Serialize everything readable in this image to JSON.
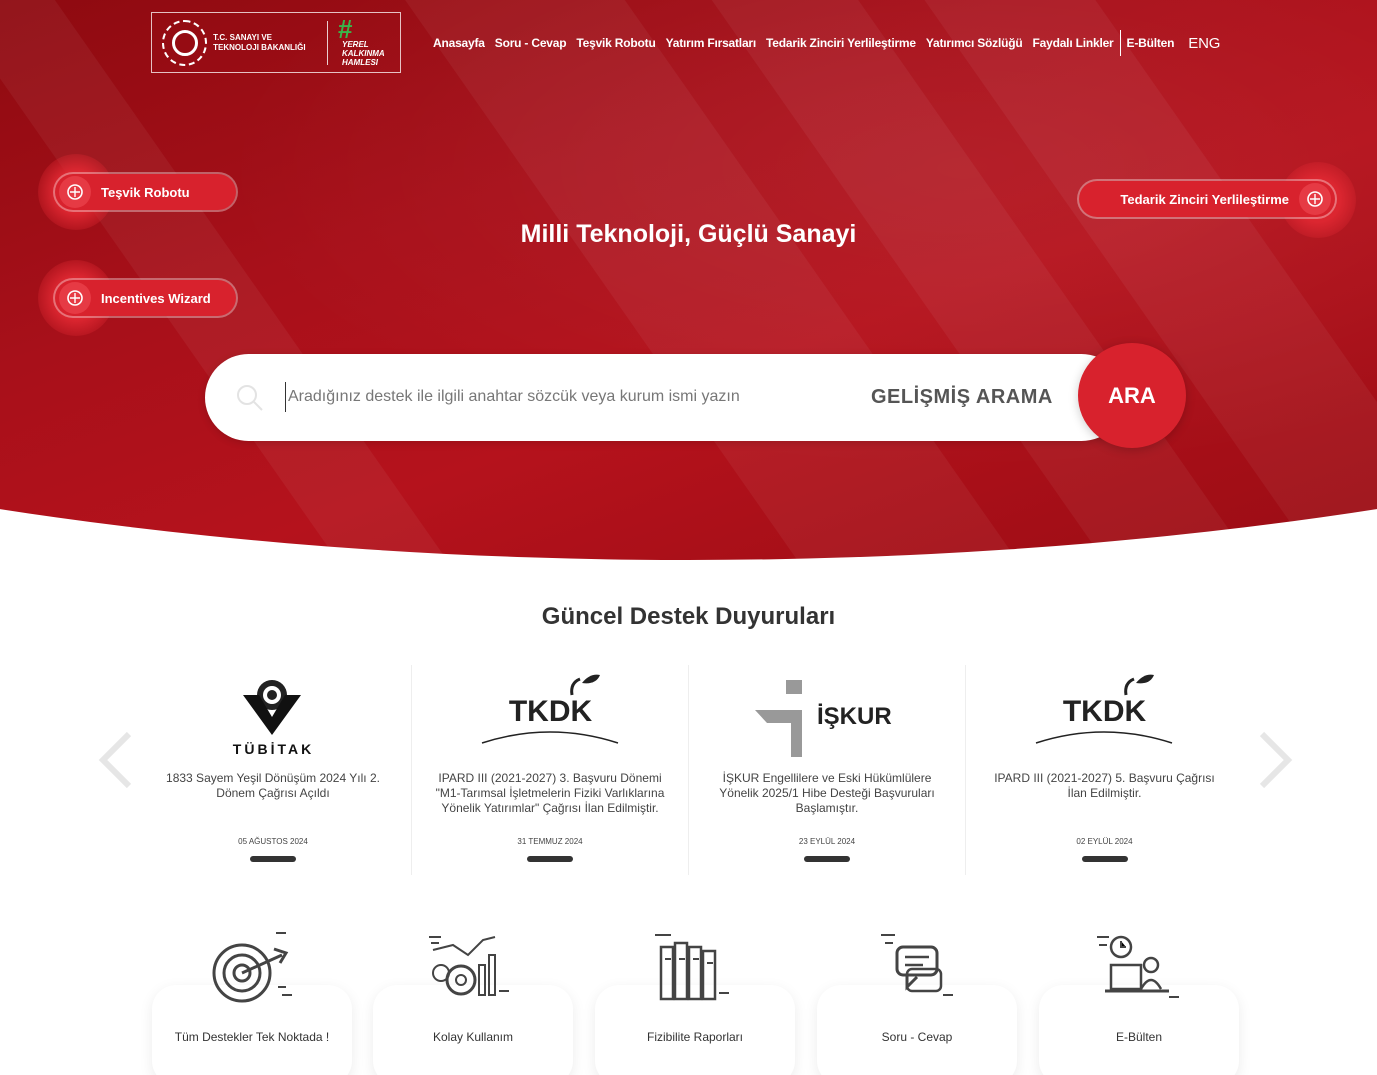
{
  "header": {
    "ministry_name": "T.C. Sanayi ve Teknoloji Bakanlığı",
    "campaign_hashtag": "#",
    "campaign_text": "Yerel Kalkınma Hamlesi",
    "nav": [
      "Anasayfa",
      "Soru - Cevap",
      "Teşvik Robotu",
      "Yatırım Fırsatları",
      "Tedarik Zinciri Yerlileştirme",
      "Yatırımcı Sözlüğü",
      "Faydalı Linkler"
    ],
    "ebulten": "E-Bülten",
    "lang": "ENG"
  },
  "hero": {
    "title": "Milli Teknoloji, Güçlü Sanayi",
    "side_buttons": {
      "tesvik": "Teşvik Robotu",
      "incentives": "Incentives Wizard",
      "tedarik": "Tedarik Zinciri Yerlileştirme"
    }
  },
  "search": {
    "placeholder": "Aradığınız destek ile ilgili anahtar sözcük veya kurum ismi yazın",
    "advanced": "GELİŞMİŞ ARAMA",
    "submit": "ARA"
  },
  "announcements": {
    "title": "Güncel Destek Duyuruları",
    "items": [
      {
        "logo_text": "TÜBİTAK",
        "title": "1833 Sayem Yeşil Dönüşüm 2024 Yılı 2. Dönem Çağrısı Açıldı",
        "date": "05 Ağustos 2024"
      },
      {
        "logo_text": "TKDK",
        "title": "IPARD III (2021-2027) 3. Başvuru Dönemi \"M1-Tarımsal İşletmelerin Fiziki Varlıklarına Yönelik Yatırımlar\" Çağrısı İlan Edilmiştir.",
        "date": "31 Temmuz 2024"
      },
      {
        "logo_text": "İŞKUR",
        "title": "İŞKUR Engellilere ve Eski Hükümlülere Yönelik 2025/1 Hibe Desteği Başvuruları Başlamıştır.",
        "date": "23 Eylül 2024"
      },
      {
        "logo_text": "TKDK",
        "title": "IPARD III (2021-2027) 5. Başvuru Çağrısı İlan Edilmiştir.",
        "date": "02 Eylül 2024"
      }
    ]
  },
  "features": [
    {
      "label": "Tüm Destekler Tek Noktada !",
      "icon": "target-icon"
    },
    {
      "label": "Kolay Kullanım",
      "icon": "gear-chart-icon"
    },
    {
      "label": "Fizibilite Raporları",
      "icon": "books-icon"
    },
    {
      "label": "Soru - Cevap",
      "icon": "chat-icon"
    },
    {
      "label": "E-Bülten",
      "icon": "desk-worker-icon"
    }
  ],
  "colors": {
    "brand_red": "#d8222d",
    "hero_dark_red": "#9a0c14",
    "text": "#333333"
  }
}
